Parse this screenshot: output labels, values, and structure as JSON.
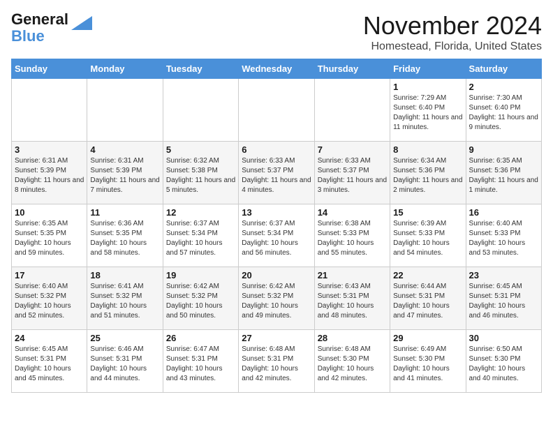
{
  "logo": {
    "general": "General",
    "blue": "Blue"
  },
  "header": {
    "month": "November 2024",
    "location": "Homestead, Florida, United States"
  },
  "weekdays": [
    "Sunday",
    "Monday",
    "Tuesday",
    "Wednesday",
    "Thursday",
    "Friday",
    "Saturday"
  ],
  "weeks": [
    [
      {
        "day": "",
        "info": ""
      },
      {
        "day": "",
        "info": ""
      },
      {
        "day": "",
        "info": ""
      },
      {
        "day": "",
        "info": ""
      },
      {
        "day": "",
        "info": ""
      },
      {
        "day": "1",
        "info": "Sunrise: 7:29 AM\nSunset: 6:40 PM\nDaylight: 11 hours and 11 minutes."
      },
      {
        "day": "2",
        "info": "Sunrise: 7:30 AM\nSunset: 6:40 PM\nDaylight: 11 hours and 9 minutes."
      }
    ],
    [
      {
        "day": "3",
        "info": "Sunrise: 6:31 AM\nSunset: 5:39 PM\nDaylight: 11 hours and 8 minutes."
      },
      {
        "day": "4",
        "info": "Sunrise: 6:31 AM\nSunset: 5:39 PM\nDaylight: 11 hours and 7 minutes."
      },
      {
        "day": "5",
        "info": "Sunrise: 6:32 AM\nSunset: 5:38 PM\nDaylight: 11 hours and 5 minutes."
      },
      {
        "day": "6",
        "info": "Sunrise: 6:33 AM\nSunset: 5:37 PM\nDaylight: 11 hours and 4 minutes."
      },
      {
        "day": "7",
        "info": "Sunrise: 6:33 AM\nSunset: 5:37 PM\nDaylight: 11 hours and 3 minutes."
      },
      {
        "day": "8",
        "info": "Sunrise: 6:34 AM\nSunset: 5:36 PM\nDaylight: 11 hours and 2 minutes."
      },
      {
        "day": "9",
        "info": "Sunrise: 6:35 AM\nSunset: 5:36 PM\nDaylight: 11 hours and 1 minute."
      }
    ],
    [
      {
        "day": "10",
        "info": "Sunrise: 6:35 AM\nSunset: 5:35 PM\nDaylight: 10 hours and 59 minutes."
      },
      {
        "day": "11",
        "info": "Sunrise: 6:36 AM\nSunset: 5:35 PM\nDaylight: 10 hours and 58 minutes."
      },
      {
        "day": "12",
        "info": "Sunrise: 6:37 AM\nSunset: 5:34 PM\nDaylight: 10 hours and 57 minutes."
      },
      {
        "day": "13",
        "info": "Sunrise: 6:37 AM\nSunset: 5:34 PM\nDaylight: 10 hours and 56 minutes."
      },
      {
        "day": "14",
        "info": "Sunrise: 6:38 AM\nSunset: 5:33 PM\nDaylight: 10 hours and 55 minutes."
      },
      {
        "day": "15",
        "info": "Sunrise: 6:39 AM\nSunset: 5:33 PM\nDaylight: 10 hours and 54 minutes."
      },
      {
        "day": "16",
        "info": "Sunrise: 6:40 AM\nSunset: 5:33 PM\nDaylight: 10 hours and 53 minutes."
      }
    ],
    [
      {
        "day": "17",
        "info": "Sunrise: 6:40 AM\nSunset: 5:32 PM\nDaylight: 10 hours and 52 minutes."
      },
      {
        "day": "18",
        "info": "Sunrise: 6:41 AM\nSunset: 5:32 PM\nDaylight: 10 hours and 51 minutes."
      },
      {
        "day": "19",
        "info": "Sunrise: 6:42 AM\nSunset: 5:32 PM\nDaylight: 10 hours and 50 minutes."
      },
      {
        "day": "20",
        "info": "Sunrise: 6:42 AM\nSunset: 5:32 PM\nDaylight: 10 hours and 49 minutes."
      },
      {
        "day": "21",
        "info": "Sunrise: 6:43 AM\nSunset: 5:31 PM\nDaylight: 10 hours and 48 minutes."
      },
      {
        "day": "22",
        "info": "Sunrise: 6:44 AM\nSunset: 5:31 PM\nDaylight: 10 hours and 47 minutes."
      },
      {
        "day": "23",
        "info": "Sunrise: 6:45 AM\nSunset: 5:31 PM\nDaylight: 10 hours and 46 minutes."
      }
    ],
    [
      {
        "day": "24",
        "info": "Sunrise: 6:45 AM\nSunset: 5:31 PM\nDaylight: 10 hours and 45 minutes."
      },
      {
        "day": "25",
        "info": "Sunrise: 6:46 AM\nSunset: 5:31 PM\nDaylight: 10 hours and 44 minutes."
      },
      {
        "day": "26",
        "info": "Sunrise: 6:47 AM\nSunset: 5:31 PM\nDaylight: 10 hours and 43 minutes."
      },
      {
        "day": "27",
        "info": "Sunrise: 6:48 AM\nSunset: 5:31 PM\nDaylight: 10 hours and 42 minutes."
      },
      {
        "day": "28",
        "info": "Sunrise: 6:48 AM\nSunset: 5:30 PM\nDaylight: 10 hours and 42 minutes."
      },
      {
        "day": "29",
        "info": "Sunrise: 6:49 AM\nSunset: 5:30 PM\nDaylight: 10 hours and 41 minutes."
      },
      {
        "day": "30",
        "info": "Sunrise: 6:50 AM\nSunset: 5:30 PM\nDaylight: 10 hours and 40 minutes."
      }
    ]
  ]
}
